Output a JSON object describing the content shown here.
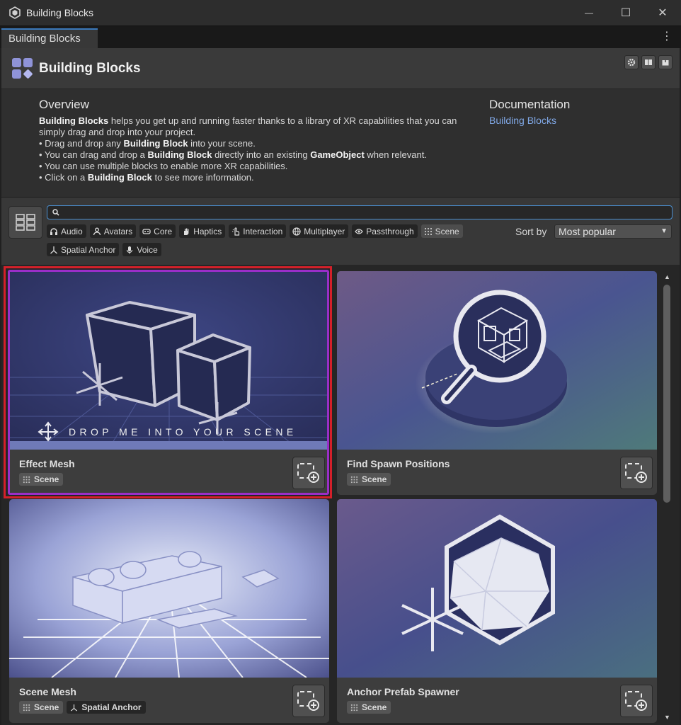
{
  "window": {
    "title": "Building Blocks",
    "min_glyph": "—",
    "max_glyph": "☐",
    "close_glyph": "✕"
  },
  "tab": {
    "label": "Building Blocks",
    "menu_glyph": "⋮"
  },
  "header": {
    "title": "Building Blocks",
    "buttons": [
      "gear-icon",
      "book-icon",
      "package-icon"
    ]
  },
  "overview": {
    "title": "Overview",
    "intro_bold": "Building Blocks",
    "intro_rest": " helps you get up and running faster thanks to a library of XR capabilities that you can simply drag and drop into your project.",
    "b1_a": "• Drag and drop any ",
    "b1_b": "Building Block",
    "b1_c": " into your scene.",
    "b2_a": "• You can drag and drop a ",
    "b2_b": "Building Block",
    "b2_c": " directly into an existing ",
    "b2_d": "GameObject",
    "b2_e": " when relevant.",
    "b3": "• You can use multiple blocks to enable more XR capabilities.",
    "b4_a": "• Click on a ",
    "b4_b": "Building Block",
    "b4_c": " to see more information."
  },
  "documentation": {
    "title": "Documentation",
    "link": "Building Blocks"
  },
  "search": {
    "value": "",
    "placeholder": ""
  },
  "tags": {
    "audio": "Audio",
    "avatars": "Avatars",
    "core": "Core",
    "haptics": "Haptics",
    "interaction": "Interaction",
    "multiplayer": "Multiplayer",
    "passthrough": "Passthrough",
    "scene": "Scene",
    "spatial_anchor": "Spatial Anchor",
    "voice": "Voice"
  },
  "sort": {
    "label": "Sort by",
    "value": "Most popular"
  },
  "cards": [
    {
      "name": "Effect Mesh",
      "tags": [
        "Scene"
      ],
      "overlay": "DROP ME INTO YOUR SCENE"
    },
    {
      "name": "Find Spawn Positions",
      "tags": [
        "Scene"
      ]
    },
    {
      "name": "Scene Mesh",
      "tags": [
        "Scene",
        "Spatial Anchor"
      ]
    },
    {
      "name": "Anchor Prefab Spawner",
      "tags": [
        "Scene"
      ]
    }
  ],
  "colors": {
    "accent": "#3a79bb",
    "link": "#80a8e6",
    "selection_outer": "#d4202a",
    "selection_inner": "#9a2ec8"
  }
}
